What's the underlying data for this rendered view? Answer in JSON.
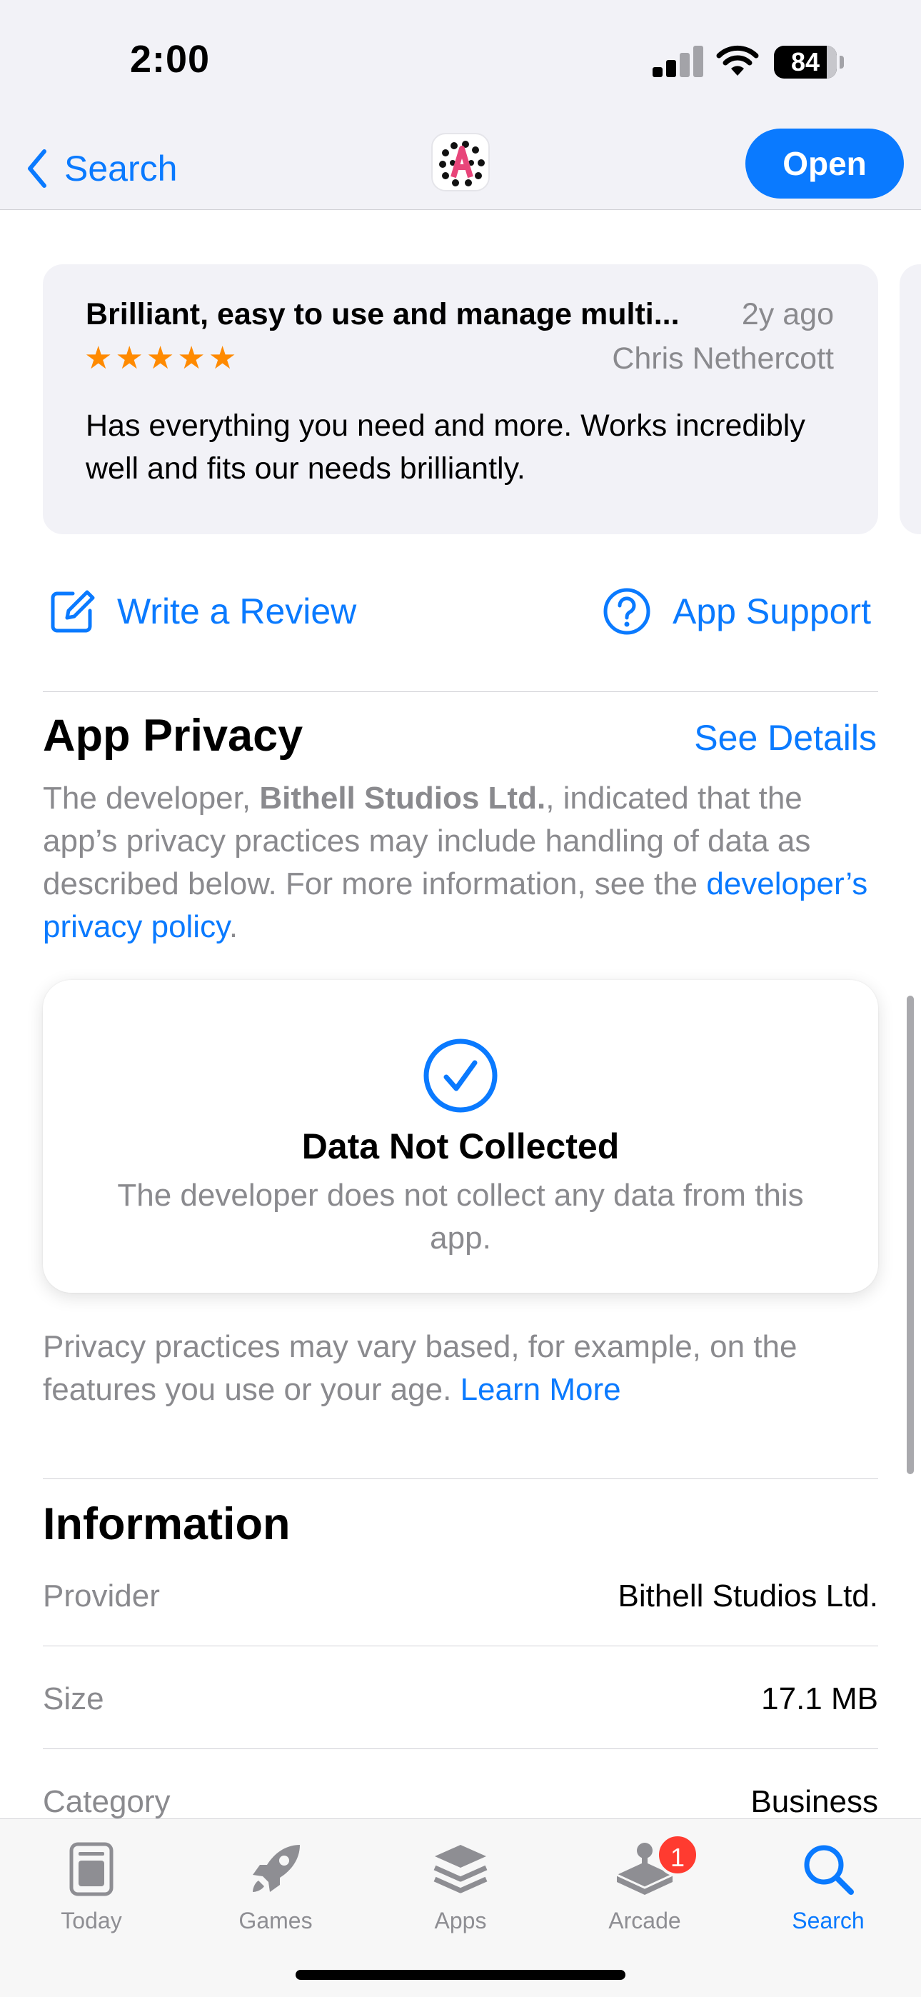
{
  "status_bar": {
    "time": "2:00",
    "battery": "84"
  },
  "nav": {
    "back_label": "Search",
    "open_label": "Open"
  },
  "review": {
    "title": "Brilliant, easy to use and manage multi...",
    "date": "2y ago",
    "author": "Chris Nethercott",
    "rating": 5,
    "body": "Has everything you need and more. Works incredibly well and fits our needs brilliantly."
  },
  "actions": {
    "write_review": "Write a Review",
    "app_support": "App Support"
  },
  "privacy": {
    "title": "App Privacy",
    "see_details": "See Details",
    "desc_prefix": "The developer, ",
    "developer": "Bithell Studios Ltd.",
    "desc_middle": ", indicated that the app’s privacy practices may include handling of data as described below. For more information, see the ",
    "policy_link": "developer’s privacy policy",
    "desc_suffix": ".",
    "card_title": "Data Not Collected",
    "card_text": "The developer does not collect any data from this app.",
    "practices_text": "Privacy practices may vary based, for example, on the features you use or your age. ",
    "learn_more": "Learn More"
  },
  "information": {
    "title": "Information",
    "rows": [
      {
        "label": "Provider",
        "value": "Bithell Studios Ltd."
      },
      {
        "label": "Size",
        "value": "17.1 MB"
      },
      {
        "label": "Category",
        "value": "Business"
      }
    ]
  },
  "tabs": [
    {
      "label": "Today",
      "icon": "today-icon"
    },
    {
      "label": "Games",
      "icon": "rocket-icon"
    },
    {
      "label": "Apps",
      "icon": "layers-icon"
    },
    {
      "label": "Arcade",
      "icon": "joystick-icon",
      "badge": "1"
    },
    {
      "label": "Search",
      "icon": "search-icon",
      "active": true
    }
  ],
  "colors": {
    "accent": "#0a7aff",
    "star": "#ff8a00",
    "badge": "#ff3b30"
  }
}
